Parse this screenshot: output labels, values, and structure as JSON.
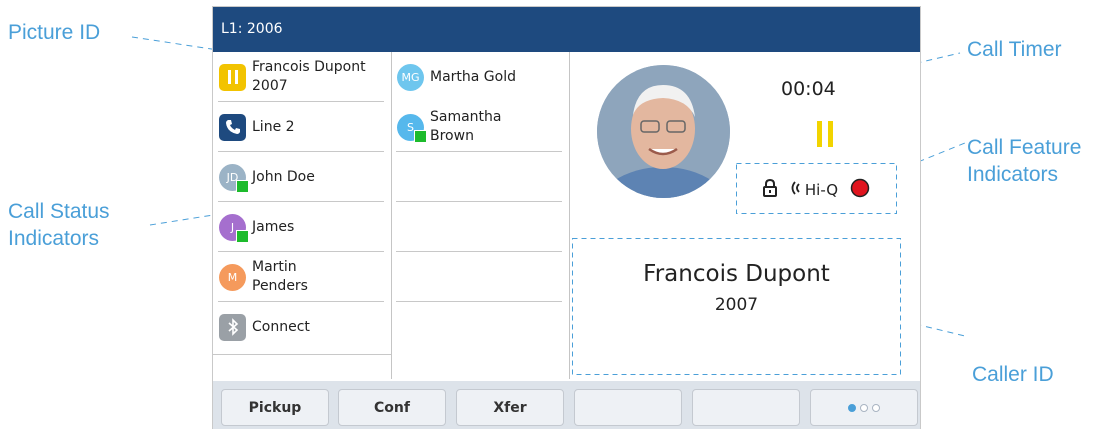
{
  "callouts": {
    "picture_id": "Picture ID",
    "call_timer": "Call Timer",
    "call_feature_1": "Call Feature",
    "call_feature_2": "Indicators",
    "call_status_1": "Call Status",
    "call_status_2": "Indicators",
    "caller_id": "Caller ID"
  },
  "header": {
    "line": "L1: 2006"
  },
  "lines_col1": [
    {
      "name": "Francois Dupont",
      "sub": "2007",
      "icon": "pause-icon",
      "color": "#f2c300"
    },
    {
      "name": "Line 2",
      "icon": "phone-icon",
      "color": "#1e4a7f"
    },
    {
      "name": "John Doe",
      "initials": "JD",
      "color": "#9bb3c6",
      "status": "available"
    },
    {
      "name": "James",
      "initials": "J",
      "color": "#a56fce",
      "status": "available"
    },
    {
      "name": "Martin",
      "sub": "Penders",
      "initials": "M",
      "color": "#f59a5c"
    },
    {
      "name": "Connect",
      "icon": "bluetooth-icon",
      "color": "#9aa0a6"
    }
  ],
  "lines_col2": [
    {
      "name": "Martha Gold",
      "initials": "MG",
      "color": "#6ec6ee"
    },
    {
      "name": "Samantha",
      "sub": "Brown",
      "initials": "S",
      "color": "#56b8ec",
      "status": "available"
    }
  ],
  "call": {
    "timer": "00:04",
    "state_icon": "hold-icon",
    "hold_color": "#f2d400",
    "features": {
      "hiq": "Hi-Q",
      "lock_icon": "lock-icon",
      "hd_icon": "hd-audio-icon",
      "record_icon": "record-icon"
    },
    "record_color": "#e0141e",
    "caller_name": "Francois Dupont",
    "caller_number": "2007"
  },
  "softkeys": [
    "Pickup",
    "Conf",
    "Xfer",
    "",
    ""
  ],
  "pager": {
    "pages": 3,
    "active": 1
  },
  "colors": {
    "accent": "#4a9fd8",
    "header_bg": "#1e4a7f",
    "status_green": "#1dbb2c"
  }
}
